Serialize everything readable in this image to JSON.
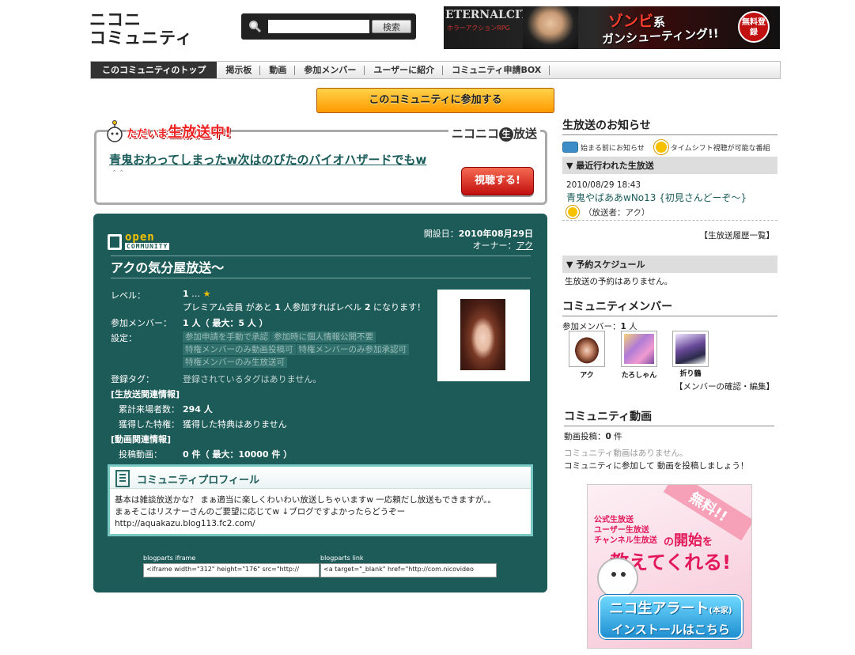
{
  "logo": {
    "line1": "ニコニ",
    "line2": "コミュニティ"
  },
  "search": {
    "placeholder": "",
    "button": "検索"
  },
  "top_ad": {
    "brand": "ETERNALCITY",
    "sub": "ホラーアクションRPG",
    "text1": "ゾンビ",
    "text1b": "系",
    "text2": "ガンシューティング!!",
    "badge": "無料登録"
  },
  "nav": [
    "このコミュニティのトップ",
    "掲示板",
    "動画",
    "参加メンバー",
    "ユーザーに紹介",
    "コミュニティ申請BOX"
  ],
  "join_button": "このコミュニティに参加する",
  "live": {
    "prefix": "ただいま",
    "headline": "生放送中!",
    "brand": "ニコニコ",
    "brand_circle": "生",
    "brand_tail": "放送",
    "title": "青鬼おわってしまったw次はのびたのバイオハザードでもw",
    "sub": "＾＾",
    "watch": "視聴する!"
  },
  "community": {
    "open_label": "open",
    "community_label": "COMMUNITY",
    "created_label": "開設日：",
    "created": "2010年08月29日",
    "owner_label": "オーナー：",
    "owner": "アク",
    "name": "アクの気分屋放送～",
    "level_label": "レベル：",
    "level": "1",
    "level_sep": "…",
    "level_star": "★",
    "premium_link": "プレミアム会員",
    "premium_text1": " があと ",
    "premium_n": "1",
    "premium_text2": " 人参加すればレベル ",
    "premium_level": "2",
    "premium_text3": " になります！",
    "members_label": "参加メンバー：",
    "members": "1 人（ 最大：5 人 ）",
    "settings_label": "設定：",
    "settings": [
      "参加申請を手動で承認",
      "参加時に個人情報公開不要",
      "特権メンバーのみ動画投稿可",
      "特権メンバーのみ参加承認可",
      "特権メンバーのみ生放送可"
    ],
    "tags_label": "登録タグ：",
    "tags": "登録されているタグはありません。",
    "live_section": "[生放送関連情報]",
    "visitors_label": "累計来場者数：",
    "visitors": "294 人",
    "privilege_label": "獲得した特権：",
    "privilege": "獲得した特典はありません",
    "video_section": "[動画関連情報]",
    "videos_label": "投稿動画：",
    "videos": "0 件（ 最大：10000 件 ）"
  },
  "profile": {
    "title": "コミュニティプロフィール",
    "line1": "基本は雑談放送かな？ まぁ適当に楽しくわいわい放送しちゃいますw 一応頼だし放送もできますが。。",
    "line2": "まぁそこはリスナーさんのご要望に応じてw ↓ブログですよかったらどうぞー",
    "line3": "http://aquakazu.blog113.fc2.com/"
  },
  "blogparts": {
    "iframe_label": "blogparts iframe",
    "iframe_code": "<iframe width=\"312\" height=\"176\" src=\"http://",
    "link_label": "blogparts link",
    "link_code": "<a target=\"_blank\" href=\"http://com.nicovideo"
  },
  "right": {
    "live_notice_title": "生放送のお知らせ",
    "legend1": "始まる前にお知らせ",
    "legend2": "タイムシフト視聴が可能な番組",
    "recent_bar": "▼ 最近行われた生放送",
    "recent_date": "2010/08/29 18:43",
    "recent_title": "青鬼やばああwNo13 {初見さんどーぞ～}",
    "recent_caster": "（放送者：アク）",
    "history_link": "【生放送履歴一覧】",
    "schedule_bar": "▼ 予約スケジュール",
    "schedule_none": "生放送の予約はありません。",
    "members_title": "コミュニティメンバー",
    "members_count_label": "参加メンバー：",
    "members_count": "1",
    "members_count_unit": " 人",
    "members": [
      {
        "name": "アク"
      },
      {
        "name": "たろしゃん"
      },
      {
        "name": "折り鶴"
      }
    ],
    "members_link": "【メンバーの確認・編集】",
    "video_title": "コミュニティ動画",
    "video_count_label": "動画投稿：",
    "video_count": "0",
    "video_count_unit": " 件",
    "video_none": "コミュニティ動画はありません。",
    "video_cta1": "コミュニティに",
    "video_cta_link": "参加して",
    "video_cta2": " 動画を投稿しましょう！"
  },
  "bottom_ad": {
    "free": "無料!!",
    "l1": "公式生放送",
    "l2": "ユーザー生放送",
    "l3": "チャンネル生放送",
    "big_a": "の",
    "big_b": "開始",
    "big_c": "を",
    "big2": "教えてくれる!",
    "cta1": "ニコ生アラート",
    "cta1_sub": "(本家)",
    "cta2": "インストールはこちら"
  }
}
